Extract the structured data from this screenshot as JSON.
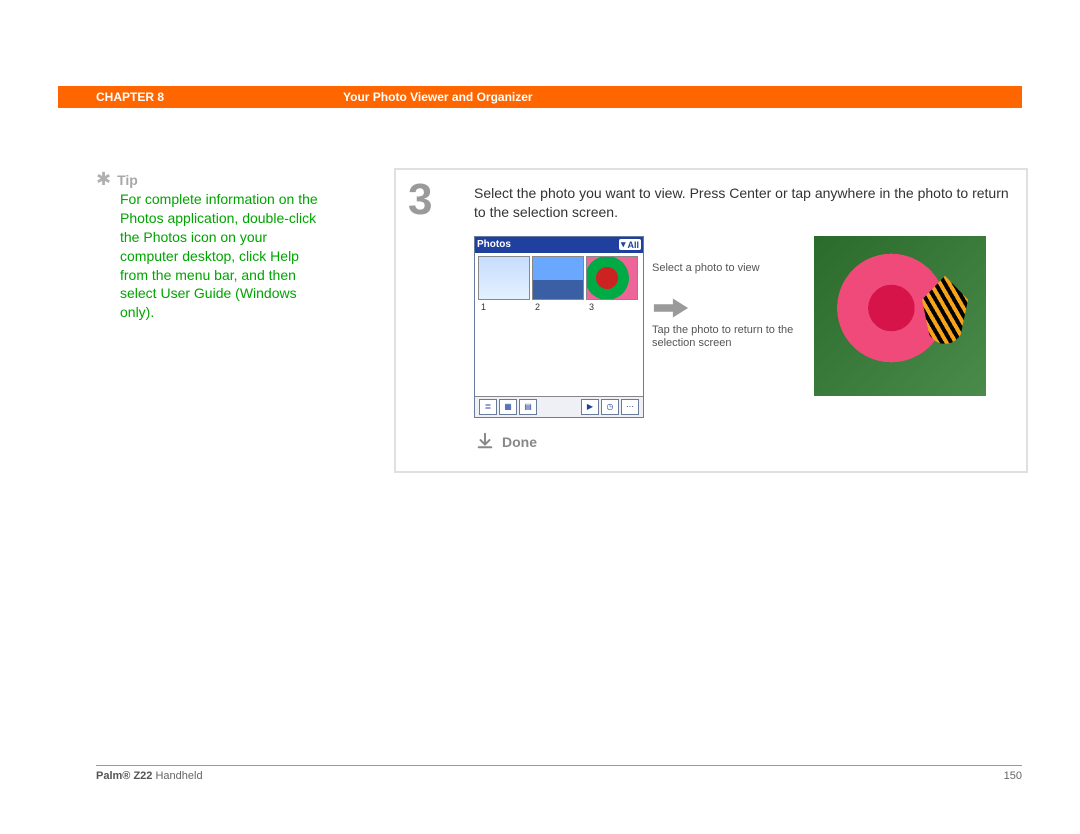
{
  "header": {
    "chapter": "CHAPTER 8",
    "title": "Your Photo Viewer and Organizer"
  },
  "sidebar": {
    "tip_label": "Tip",
    "tip_body": "For complete information on the Photos application, double-click the Photos icon on your computer desktop, click Help from the menu bar, and then select User Guide (Windows only)."
  },
  "step": {
    "number": "3",
    "instruction": "Select the photo you want to view. Press Center or tap anywhere in the photo to return to the selection screen.",
    "done_label": "Done"
  },
  "photos_app": {
    "title": "Photos",
    "category": "All",
    "thumbs": [
      "1",
      "2",
      "3"
    ]
  },
  "callouts": {
    "c1": "Select a photo to view",
    "c2": "Tap the photo to return to the selection screen"
  },
  "footer": {
    "product_bold": "Palm® Z22",
    "product_rest": " Handheld",
    "page": "150"
  }
}
